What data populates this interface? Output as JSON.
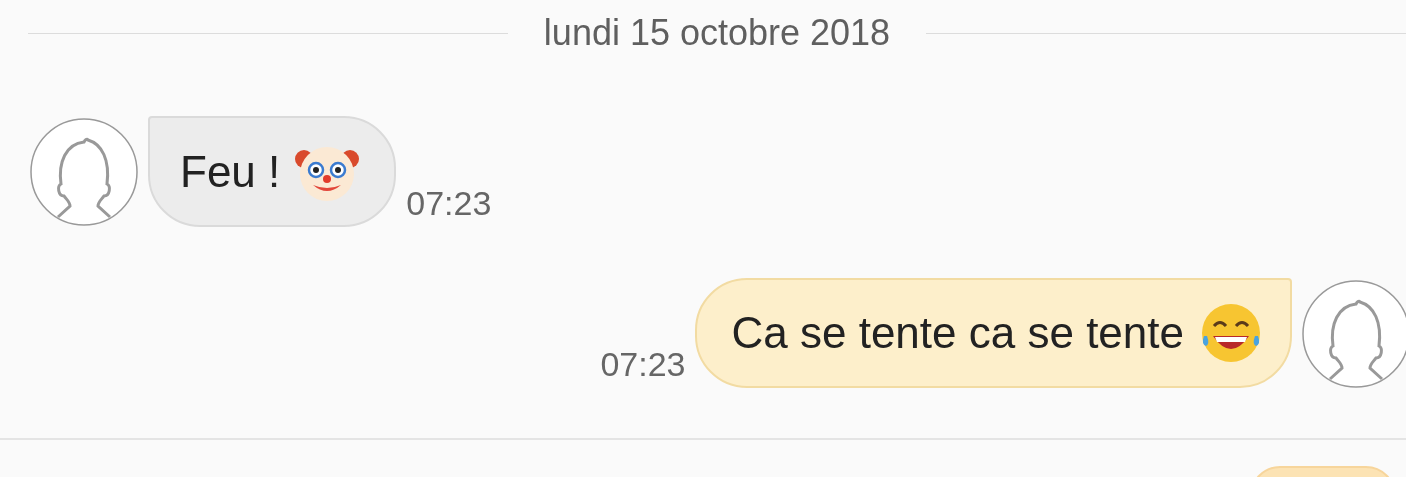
{
  "date_header": "lundi 15 octobre 2018",
  "messages": [
    {
      "kind": "incoming",
      "text": "Feu !",
      "time": "07:23"
    },
    {
      "kind": "outgoing",
      "text": "Ca se tente ca se tente",
      "time": "07:23"
    }
  ]
}
